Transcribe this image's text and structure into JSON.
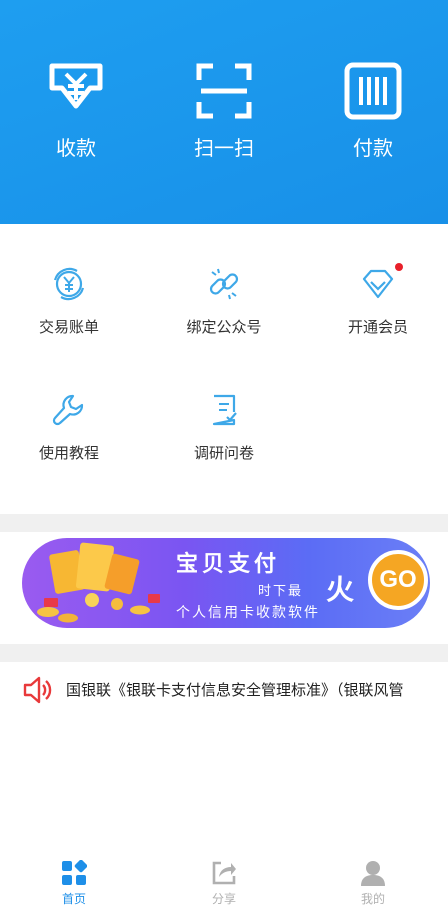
{
  "header": {
    "actions": [
      {
        "label": "收款",
        "icon": "yuan-download-icon"
      },
      {
        "label": "扫一扫",
        "icon": "scan-icon"
      },
      {
        "label": "付款",
        "icon": "barcode-icon"
      }
    ]
  },
  "grid": {
    "items": [
      {
        "label": "交易账单",
        "icon": "yuan-cycle-icon"
      },
      {
        "label": "绑定公众号",
        "icon": "link-icon"
      },
      {
        "label": "开通会员",
        "icon": "diamond-icon",
        "badge": true
      },
      {
        "label": "使用教程",
        "icon": "wrench-icon"
      },
      {
        "label": "调研问卷",
        "icon": "survey-icon"
      }
    ]
  },
  "banner": {
    "title": "宝贝支付",
    "sub1": "时下最",
    "hot": "火",
    "sub2": "个人信用卡收款软件",
    "go": "GO"
  },
  "notice": {
    "text": "国银联《银联卡支付信息安全管理标准》（银联风管",
    "icon": "speaker-icon"
  },
  "tabbar": {
    "tabs": [
      {
        "label": "首页",
        "icon": "home-grid-icon",
        "active": true
      },
      {
        "label": "分享",
        "icon": "share-icon",
        "active": false
      },
      {
        "label": "我的",
        "icon": "user-icon",
        "active": false
      }
    ]
  },
  "colors": {
    "header_bg": "#1e9ef0",
    "icon_blue": "#3ea8e8",
    "badge_red": "#e8202a",
    "tab_active": "#1e8fe8",
    "tab_inactive": "#b0b0b0",
    "go_orange": "#f5a623"
  }
}
